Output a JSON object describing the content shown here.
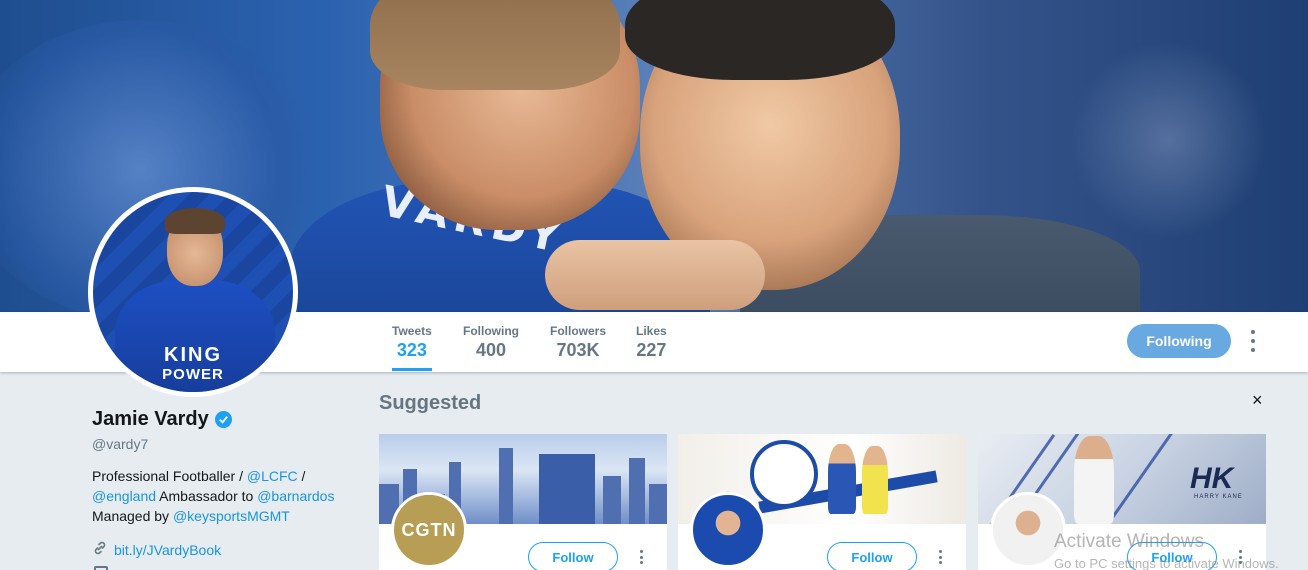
{
  "profile": {
    "name": "Jamie Vardy",
    "handle": "@vardy7",
    "bio_prefix": "Professional Footballer / ",
    "bio_link1": "@LCFC",
    "bio_sep": " /",
    "bio_link2": "@england",
    "bio_mid": " Ambassador to ",
    "bio_link3": "@barnardos",
    "bio_managed": "Managed by ",
    "bio_link4": "@keysportsMGMT",
    "website": "bit.ly/JVardyBook",
    "verified_icon": "verified-badge-icon",
    "avatar_shirt_line1": "KING",
    "avatar_shirt_line2": "POWER"
  },
  "banner": {
    "shirt_text": "VARDY"
  },
  "stats": [
    {
      "label": "Tweets",
      "value": "323",
      "active": true
    },
    {
      "label": "Following",
      "value": "400",
      "active": false
    },
    {
      "label": "Followers",
      "value": "703K",
      "active": false
    },
    {
      "label": "Likes",
      "value": "227",
      "active": false
    }
  ],
  "actions": {
    "following_label": "Following"
  },
  "suggested": {
    "title": "Suggested",
    "close": "×",
    "cards": [
      {
        "avatar_text": "CGTN",
        "follow_label": "Follow"
      },
      {
        "follow_label": "Follow"
      },
      {
        "banner_logo": "HK",
        "banner_sub": "HARRY KANE",
        "follow_label": "Follow"
      }
    ]
  },
  "watermark": {
    "line1": "Activate Windows",
    "line2": "Go to PC settings to activate Windows."
  },
  "colors": {
    "accent": "#1da1f2",
    "following_button": "#67a9e0",
    "background": "#e6ecf0"
  }
}
